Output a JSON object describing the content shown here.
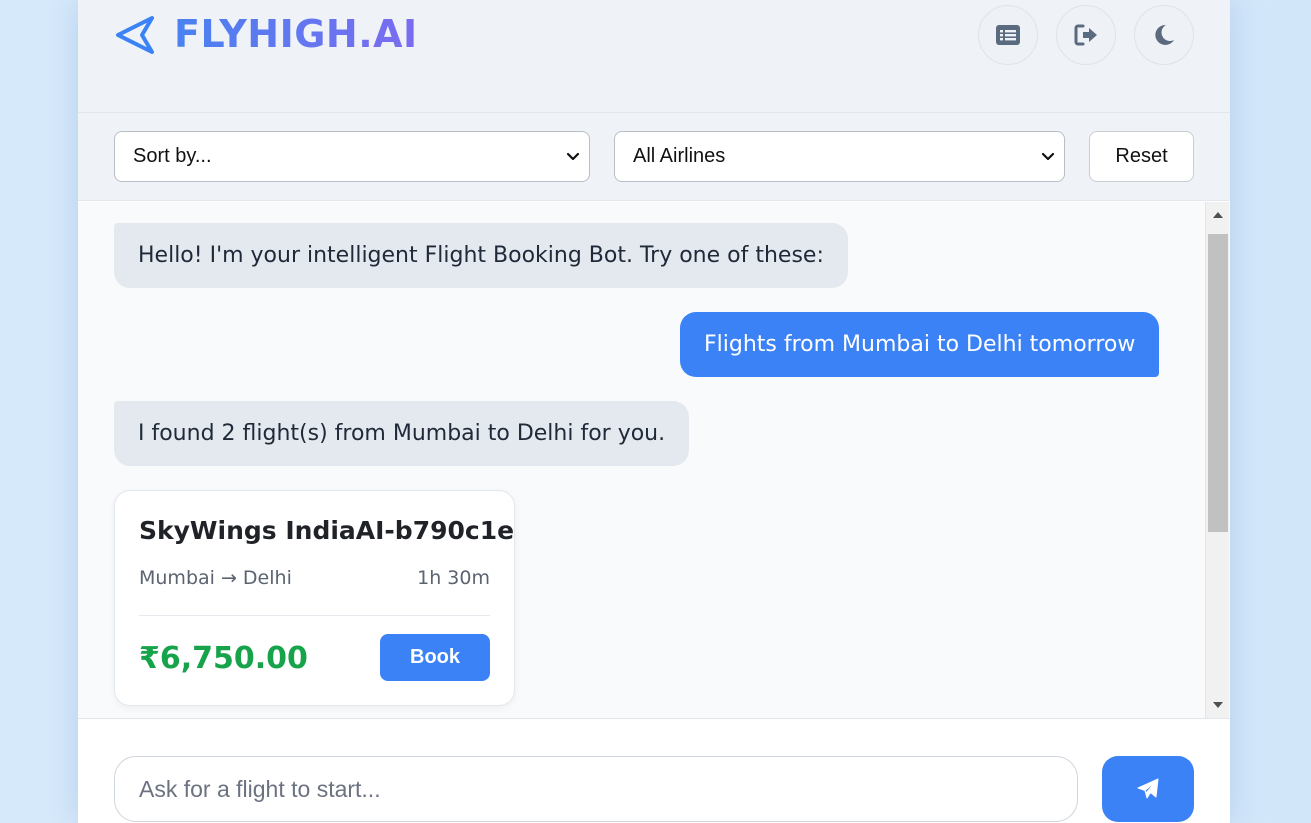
{
  "header": {
    "logo_text": "FLYHIGH.AI",
    "logo_icon": "paper-plane-outline-icon",
    "buttons": [
      {
        "name": "history",
        "icon": "list-icon"
      },
      {
        "name": "logout",
        "icon": "sign-out-icon"
      },
      {
        "name": "theme",
        "icon": "moon-icon"
      }
    ]
  },
  "filters": {
    "sort_selected": "Sort by...",
    "airline_selected": "All Airlines",
    "reset_label": "Reset"
  },
  "chat": {
    "messages": [
      {
        "role": "bot",
        "text": "Hello! I'm your intelligent Flight Booking Bot. Try one of these:"
      },
      {
        "role": "user",
        "text": "Flights from Mumbai to Delhi tomorrow"
      },
      {
        "role": "bot",
        "text": "I found 2 flight(s) from Mumbai to Delhi for you."
      }
    ],
    "flight_card": {
      "title": "SkyWings IndiaAI-b790c1e",
      "route": "Mumbai → Delhi",
      "duration": "1h 30m",
      "price": "₹6,750.00",
      "book_label": "Book"
    }
  },
  "input": {
    "placeholder": "Ask for a flight to start...",
    "value": ""
  },
  "colors": {
    "accent": "#3b82f6",
    "price": "#16a34a",
    "bot_bubble": "#e4e9f0",
    "logo_gradient_start": "#4a82f0",
    "logo_gradient_end": "#7b6cf0"
  }
}
